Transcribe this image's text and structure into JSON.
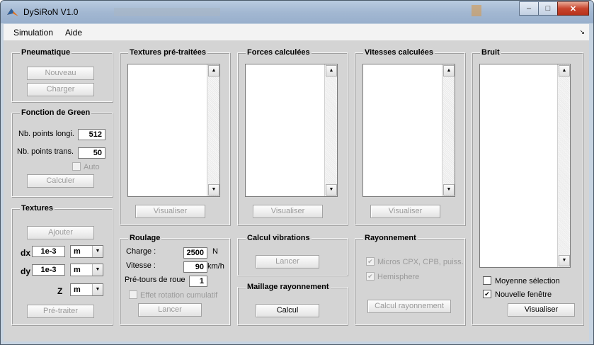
{
  "window": {
    "title": "DySiRoN V1.0",
    "buttons": {
      "minimize": "‒",
      "maximize": "□",
      "close": "✕"
    }
  },
  "menu": {
    "items": [
      "Simulation",
      "Aide"
    ],
    "arrow": "↘"
  },
  "pneumatique": {
    "title": "Pneumatique",
    "nouveau": "Nouveau",
    "charger": "Charger"
  },
  "green": {
    "title": "Fonction de Green",
    "nb_longi_label": "Nb. points longi.",
    "nb_longi_value": "512",
    "nb_trans_label": "Nb. points trans.",
    "nb_trans_value": "50",
    "auto_label": "Auto",
    "auto_checked": false,
    "calculer": "Calculer"
  },
  "textures": {
    "title": "Textures",
    "ajouter": "Ajouter",
    "dx_label": "dx",
    "dx_value": "1e-3",
    "dx_unit": "m",
    "dy_label": "dy",
    "dy_value": "1e-3",
    "dy_unit": "m",
    "z_label": "Z",
    "z_unit": "m",
    "pretraiter": "Pré-traiter"
  },
  "textures_pretraitees": {
    "title": "Textures pré-traitées",
    "visualiser": "Visualiser"
  },
  "forces": {
    "title": "Forces calculées",
    "visualiser": "Visualiser"
  },
  "vitesses": {
    "title": "Vitesses calculées",
    "visualiser": "Visualiser"
  },
  "bruit": {
    "title": "Bruit",
    "moyenne_label": "Moyenne sélection",
    "moyenne_checked": false,
    "nouvelle_label": "Nouvelle fenêtre",
    "nouvelle_checked": true,
    "visualiser": "Visualiser"
  },
  "roulage": {
    "title": "Roulage",
    "charge_label": "Charge :",
    "charge_value": "2500",
    "charge_unit": "N",
    "vitesse_label": "Vitesse :",
    "vitesse_value": "90",
    "vitesse_unit": "km/h",
    "pretours_label": "Pré-tours de roue",
    "pretours_value": "1",
    "effet_label": "Effet rotation cumulatif",
    "effet_checked": false,
    "lancer": "Lancer"
  },
  "vibrations": {
    "title": "Calcul vibrations",
    "lancer": "Lancer"
  },
  "maillage": {
    "title": "Maillage rayonnement",
    "calcul": "Calcul"
  },
  "rayonnement": {
    "title": "Rayonnement",
    "micros_label": "Micros CPX, CPB, puiss.",
    "micros_checked": true,
    "hemisphere_label": "Hemisphere",
    "hemisphere_checked": true,
    "calcul_button": "Calcul rayonnement"
  },
  "icons": {
    "check": "✔",
    "scroll_up": "▲",
    "scroll_down": "▼",
    "dropdown": "▼"
  }
}
